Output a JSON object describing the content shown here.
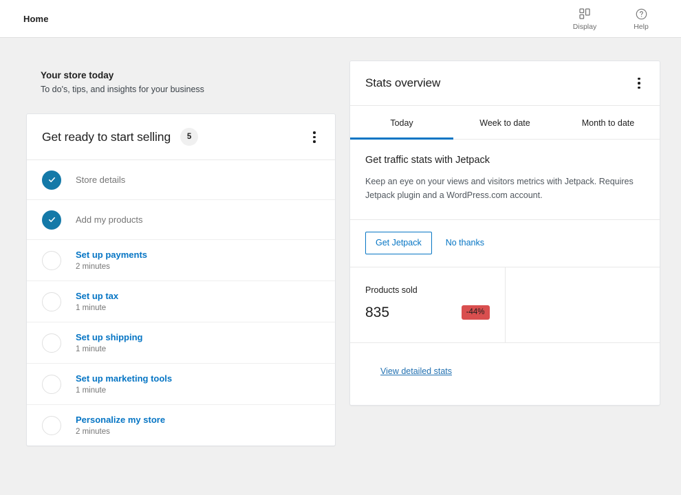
{
  "header": {
    "title": "Home",
    "actions": [
      {
        "label": "Display",
        "icon": "display-grid-icon"
      },
      {
        "label": "Help",
        "icon": "help-circle-icon"
      }
    ]
  },
  "intro": {
    "heading": "Your store today",
    "subheading": "To do's, tips, and insights for your business"
  },
  "tasklist": {
    "title": "Get ready to start selling",
    "count": "5",
    "menu_icon": "ellipsis-vertical-icon",
    "tasks": [
      {
        "label": "Store details",
        "time": "",
        "completed": true
      },
      {
        "label": "Add my products",
        "time": "",
        "completed": true
      },
      {
        "label": "Set up payments",
        "time": "2 minutes",
        "completed": false
      },
      {
        "label": "Set up tax",
        "time": "1 minute",
        "completed": false
      },
      {
        "label": "Set up shipping",
        "time": "1 minute",
        "completed": false
      },
      {
        "label": "Set up marketing tools",
        "time": "1 minute",
        "completed": false
      },
      {
        "label": "Personalize my store",
        "time": "2 minutes",
        "completed": false
      }
    ]
  },
  "stats": {
    "title": "Stats overview",
    "menu_icon": "ellipsis-vertical-icon",
    "tabs": [
      {
        "label": "Today",
        "active": true
      },
      {
        "label": "Week to date",
        "active": false
      },
      {
        "label": "Month to date",
        "active": false
      }
    ],
    "jetpack": {
      "title": "Get traffic stats with Jetpack",
      "description": "Keep an eye on your views and visitors metrics with Jetpack. Requires Jetpack plugin and a WordPress.com account.",
      "primary_label": "Get Jetpack",
      "secondary_label": "No thanks"
    },
    "metrics": [
      {
        "label": "Products sold",
        "value": "835",
        "delta": "-44%",
        "delta_color": "#d94f4f"
      }
    ],
    "footer_link": "View detailed stats"
  },
  "colors": {
    "accent_blue": "#0675c4",
    "check_blue": "#1479a8",
    "negative_red": "#d94f4f",
    "page_bg": "#f0f0f0",
    "card_bg": "#ffffff",
    "link_blue": "#2271b1"
  }
}
